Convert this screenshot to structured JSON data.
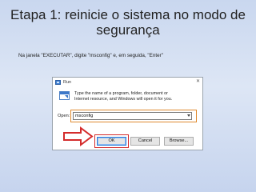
{
  "slide": {
    "title_line1": "Etapa 1: reinicie o sistema no modo de",
    "title_line2": "segurança",
    "instruction": "Na janela \"EXECUTAR\", digite \"msconfig\" e, em seguida, \"Enter\""
  },
  "run_dialog": {
    "title": "Run",
    "close_glyph": "✕",
    "description_line1": "Type the name of a program, folder, document or",
    "description_line2": "Internet resource, and Windows will open it for you.",
    "open_label": "Open:",
    "open_value": "msconfig",
    "ok_label": "OK",
    "cancel_label": "Cancel",
    "browse_label": "Browse...",
    "icons": [
      "run-icon",
      "close-icon",
      "dropdown-arrow-icon",
      "arrow-icon"
    ]
  },
  "colors": {
    "field_highlight": "#e08a2e",
    "ok_highlight": "#d42c2c",
    "arrow_fill": "#ffffff",
    "arrow_stroke": "#d42c2c"
  }
}
